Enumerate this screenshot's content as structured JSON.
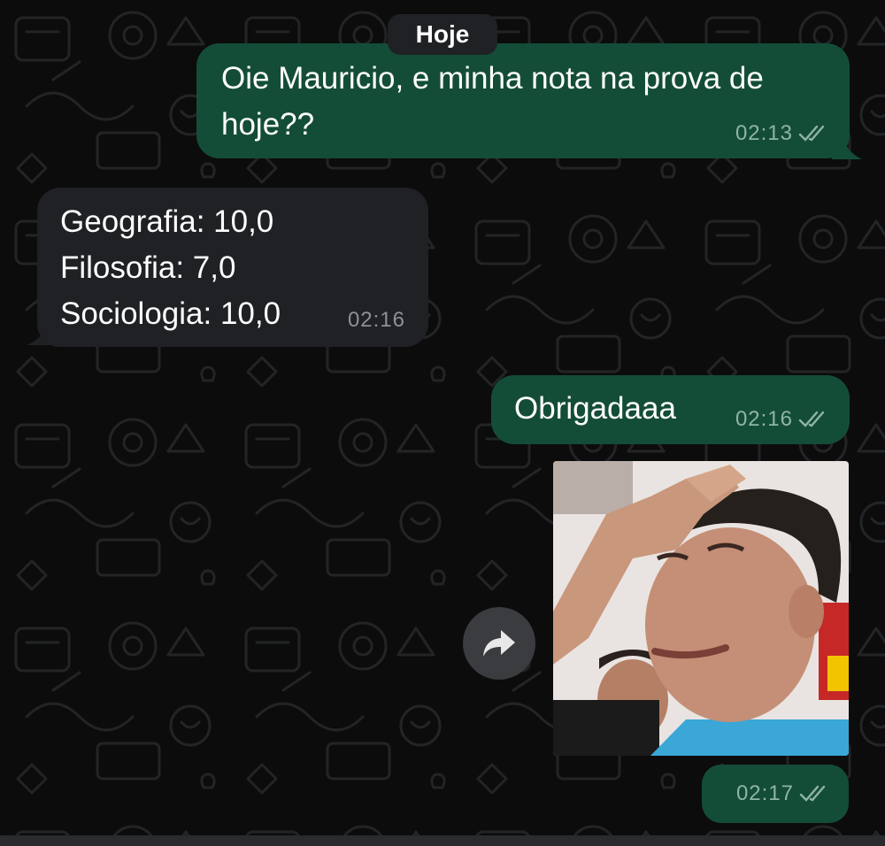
{
  "date_divider": "Hoje",
  "messages": [
    {
      "direction": "outgoing",
      "text": "Oie Mauricio, e minha nota na prova de hoje??",
      "time": "02:13",
      "status": "read"
    },
    {
      "direction": "incoming",
      "lines": [
        "Geografia: 10,0",
        "Filosofia: 7,0",
        "Sociologia: 10,0"
      ],
      "time": "02:16"
    },
    {
      "direction": "outgoing",
      "text": "Obrigadaaa",
      "time": "02:16",
      "status": "read"
    },
    {
      "direction": "outgoing",
      "type": "image",
      "image_icon": "reaction-photo-man-hand-on-forehead",
      "time": "02:17",
      "status": "read"
    }
  ],
  "icons": {
    "forward": "share-forward-icon",
    "ticks": "double-check-icon"
  },
  "colors": {
    "background": "#0c0c0c",
    "outgoing_bubble": "#144d37",
    "incoming_bubble": "#1f2124",
    "meta_outgoing": "#8fb5a4",
    "meta_incoming": "#8d9196"
  }
}
